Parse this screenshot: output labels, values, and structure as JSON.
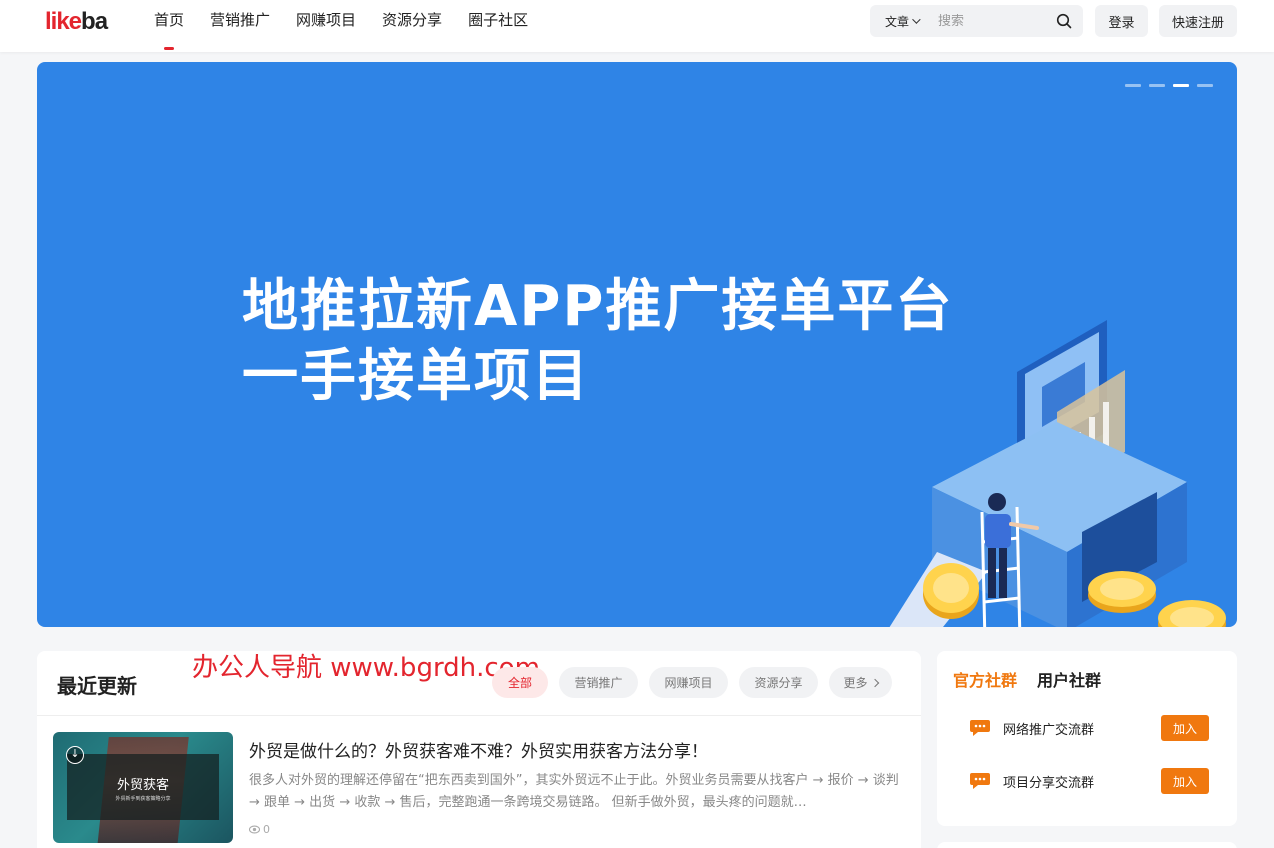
{
  "brand": {
    "logo_a": "like",
    "logo_b": "ba"
  },
  "nav": {
    "items": [
      {
        "label": "首页",
        "active": true
      },
      {
        "label": "营销推广",
        "active": false
      },
      {
        "label": "网赚项目",
        "active": false
      },
      {
        "label": "资源分享",
        "active": false
      },
      {
        "label": "圈子社区",
        "active": false
      }
    ]
  },
  "search": {
    "type_label": "文章",
    "placeholder": "搜索"
  },
  "auth": {
    "login": "登录",
    "register": "快速注册"
  },
  "banner": {
    "line1": "地推拉新APP推广接单平台",
    "line2": "一手接单项目",
    "slide_count": 4,
    "active_slide": 3
  },
  "recent": {
    "title": "最近更新",
    "watermark": "办公人导航  www.bgrdh.com",
    "filters": [
      "全部",
      "营销推广",
      "网赚项目",
      "资源分享"
    ],
    "more_label": "更多",
    "post": {
      "thumb_title": "外贸获客",
      "thumb_subtitle": "外贸新手到获客策略分享",
      "title": "外贸是做什么的？外贸获客难不难？外贸实用获客方法分享！",
      "excerpt": "很多人对外贸的理解还停留在“把东西卖到国外”，其实外贸远不止于此。外贸业务员需要从找客户 → 报价 → 谈判 → 跟单 → 出货 → 收款 → 售后，完整跑通一条跨境交易链路。 但新手做外贸，最头疼的问题就…",
      "views": "0"
    }
  },
  "community": {
    "tabs": [
      "官方社群",
      "用户社群"
    ],
    "groups": [
      {
        "name": "网络推广交流群",
        "button": "加入"
      },
      {
        "name": "项目分享交流群",
        "button": "加入"
      }
    ]
  },
  "colors": {
    "accent_red": "#e3252e",
    "banner_blue": "#2f84e6",
    "orange": "#f0780f"
  }
}
